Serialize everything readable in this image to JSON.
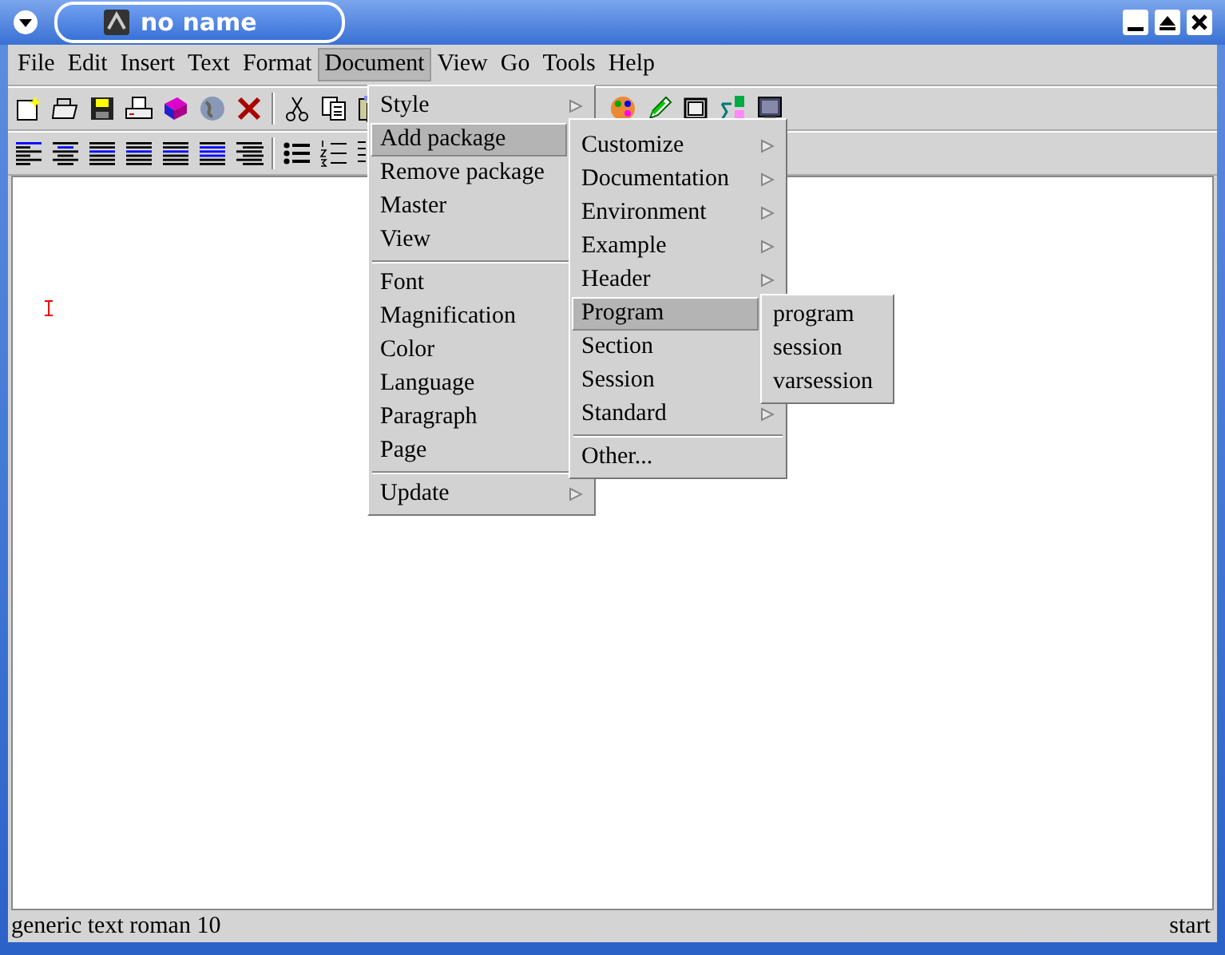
{
  "window": {
    "title": "no name"
  },
  "menubar": [
    {
      "label": "File",
      "selected": false
    },
    {
      "label": "Edit",
      "selected": false
    },
    {
      "label": "Insert",
      "selected": false
    },
    {
      "label": "Text",
      "selected": false
    },
    {
      "label": "Format",
      "selected": false
    },
    {
      "label": "Document",
      "selected": true
    },
    {
      "label": "View",
      "selected": false
    },
    {
      "label": "Go",
      "selected": false
    },
    {
      "label": "Tools",
      "selected": false
    },
    {
      "label": "Help",
      "selected": false
    }
  ],
  "document_menu": {
    "sections": [
      [
        {
          "label": "Style",
          "submenu": true,
          "selected": false
        },
        {
          "label": "Add package",
          "selected": true
        },
        {
          "label": "Remove package",
          "selected": false
        },
        {
          "label": "Master",
          "selected": false
        },
        {
          "label": "View",
          "selected": false
        }
      ],
      [
        {
          "label": "Font",
          "selected": false
        },
        {
          "label": "Magnification",
          "selected": false
        },
        {
          "label": "Color",
          "selected": false
        },
        {
          "label": "Language",
          "selected": false
        },
        {
          "label": "Paragraph",
          "selected": false
        },
        {
          "label": "Page",
          "selected": false
        }
      ],
      [
        {
          "label": "Update",
          "submenu": true,
          "selected": false
        }
      ]
    ]
  },
  "package_menu": {
    "sections": [
      [
        {
          "label": "Customize",
          "submenu": true,
          "selected": false
        },
        {
          "label": "Documentation",
          "submenu": true,
          "selected": false
        },
        {
          "label": "Environment",
          "submenu": true,
          "selected": false
        },
        {
          "label": "Example",
          "submenu": true,
          "selected": false
        },
        {
          "label": "Header",
          "submenu": true,
          "selected": false
        },
        {
          "label": "Program",
          "selected": true
        },
        {
          "label": "Section",
          "selected": false
        },
        {
          "label": "Session",
          "selected": false
        },
        {
          "label": "Standard",
          "submenu": true,
          "selected": false
        }
      ],
      [
        {
          "label": "Other...",
          "selected": false
        }
      ]
    ]
  },
  "program_menu": {
    "sections": [
      [
        {
          "label": "program",
          "selected": false
        },
        {
          "label": "session",
          "selected": false
        },
        {
          "label": "varsession",
          "selected": false
        }
      ]
    ]
  },
  "status_bar": {
    "left": "generic text roman 10",
    "right": "start"
  }
}
